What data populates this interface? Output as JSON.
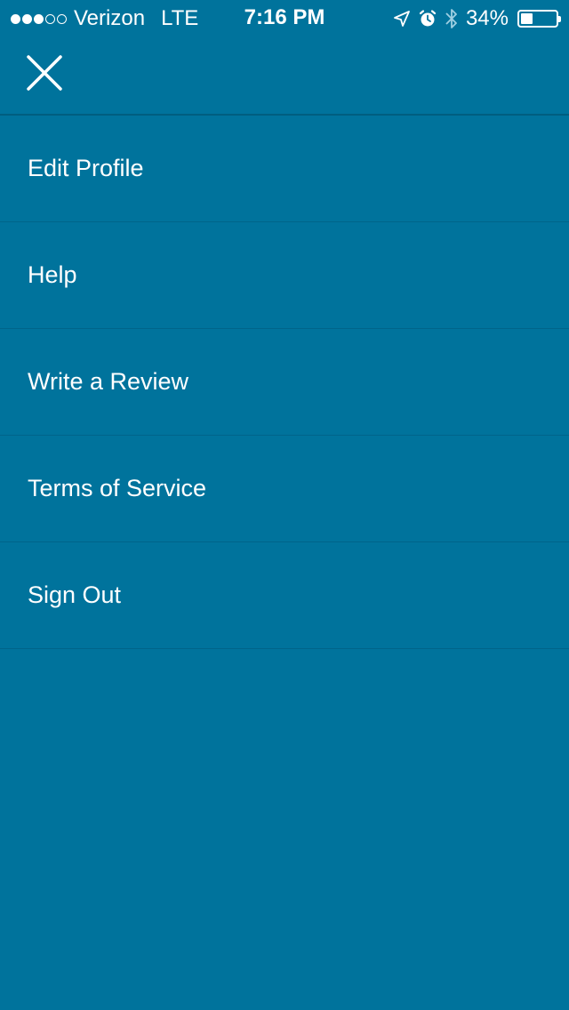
{
  "status_bar": {
    "carrier": "Verizon",
    "network": "LTE",
    "time": "7:16 PM",
    "battery_text": "34%",
    "battery_level": 0.34,
    "signal_filled": 3,
    "signal_total": 5,
    "icons": [
      "location-arrow-icon",
      "alarm-clock-icon",
      "bluetooth-icon",
      "battery-icon"
    ]
  },
  "header": {
    "close_icon": "close-icon"
  },
  "menu": {
    "items": [
      {
        "label": "Edit Profile"
      },
      {
        "label": "Help"
      },
      {
        "label": "Write a Review"
      },
      {
        "label": "Terms of Service"
      },
      {
        "label": "Sign Out"
      }
    ]
  },
  "colors": {
    "background": "#00739C",
    "divider": "#00648A",
    "text": "#FFFFFF"
  }
}
